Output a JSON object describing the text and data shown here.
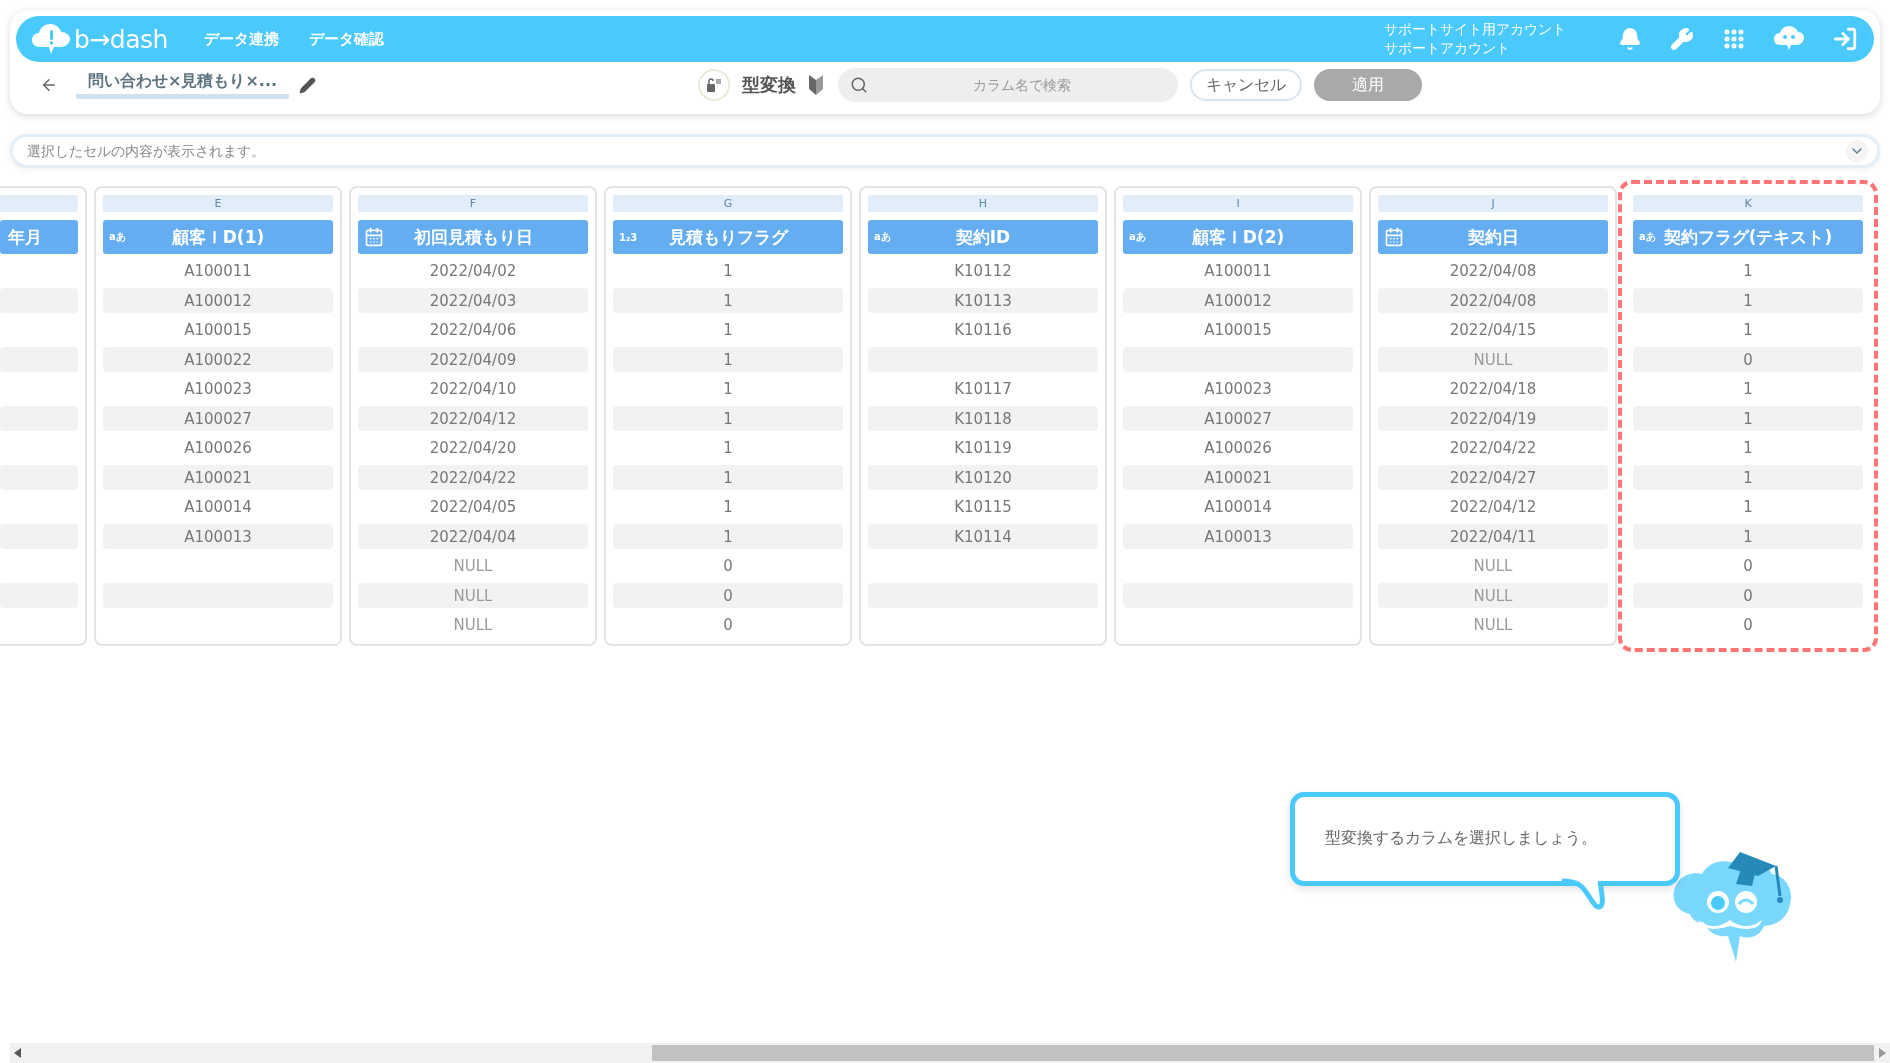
{
  "header": {
    "logo": "b→dash",
    "nav": [
      {
        "label": "データ連携"
      },
      {
        "label": "データ確認"
      }
    ],
    "account": {
      "line1": "サポートサイト用アカウント",
      "line2": "サポートアカウント"
    }
  },
  "toolbar": {
    "title": "問い合わせ×見積もり×...",
    "mode_label": "型変換",
    "search": {
      "placeholder": "カラム名で検索"
    },
    "cancel": {
      "label": "キャンセル",
      "disabled": false
    },
    "apply": {
      "label": "適用",
      "disabled": true
    }
  },
  "cell_bar": {
    "placeholder": "選択したセルの内容が表示されます。"
  },
  "columns": [
    {
      "kind": "partial",
      "title": "年月",
      "highlighted": false,
      "cells": [
        {
          "kind": "empty"
        },
        {
          "kind": "empty"
        },
        {
          "kind": "empty"
        },
        {
          "kind": "empty"
        },
        {
          "kind": "empty"
        },
        {
          "kind": "empty"
        },
        {
          "kind": "empty"
        },
        {
          "kind": "empty"
        },
        {
          "kind": "empty"
        },
        {
          "kind": "empty"
        },
        {
          "kind": "empty"
        },
        {
          "kind": "empty"
        },
        {
          "kind": "empty"
        }
      ]
    },
    {
      "letter": "E",
      "kind": "text",
      "type_label": "aあ",
      "title": "顧客ＩD(1)",
      "highlighted": false,
      "cells": [
        {
          "kind": "value",
          "text": "A100011"
        },
        {
          "kind": "value",
          "text": "A100012"
        },
        {
          "kind": "value",
          "text": "A100015"
        },
        {
          "kind": "value",
          "text": "A100022"
        },
        {
          "kind": "value",
          "text": "A100023"
        },
        {
          "kind": "value",
          "text": "A100027"
        },
        {
          "kind": "value",
          "text": "A100026"
        },
        {
          "kind": "value",
          "text": "A100021"
        },
        {
          "kind": "value",
          "text": "A100014"
        },
        {
          "kind": "value",
          "text": "A100013"
        },
        {
          "kind": "empty"
        },
        {
          "kind": "empty"
        },
        {
          "kind": "empty"
        }
      ]
    },
    {
      "letter": "F",
      "kind": "date",
      "title": "初回見積もり日",
      "highlighted": false,
      "cells": [
        {
          "kind": "value",
          "text": "2022/04/02"
        },
        {
          "kind": "value",
          "text": "2022/04/03"
        },
        {
          "kind": "value",
          "text": "2022/04/06"
        },
        {
          "kind": "value",
          "text": "2022/04/09"
        },
        {
          "kind": "value",
          "text": "2022/04/10"
        },
        {
          "kind": "value",
          "text": "2022/04/12"
        },
        {
          "kind": "value",
          "text": "2022/04/20"
        },
        {
          "kind": "value",
          "text": "2022/04/22"
        },
        {
          "kind": "value",
          "text": "2022/04/05"
        },
        {
          "kind": "value",
          "text": "2022/04/04"
        },
        {
          "kind": "null",
          "text": "NULL"
        },
        {
          "kind": "null",
          "text": "NULL"
        },
        {
          "kind": "null",
          "text": "NULL"
        }
      ]
    },
    {
      "letter": "G",
      "kind": "number",
      "type_label": "1₂3",
      "title": "見積もりフラグ",
      "highlighted": false,
      "cells": [
        {
          "kind": "value",
          "text": "1"
        },
        {
          "kind": "value",
          "text": "1"
        },
        {
          "kind": "value",
          "text": "1"
        },
        {
          "kind": "value",
          "text": "1"
        },
        {
          "kind": "value",
          "text": "1"
        },
        {
          "kind": "value",
          "text": "1"
        },
        {
          "kind": "value",
          "text": "1"
        },
        {
          "kind": "value",
          "text": "1"
        },
        {
          "kind": "value",
          "text": "1"
        },
        {
          "kind": "value",
          "text": "1"
        },
        {
          "kind": "value",
          "text": "0"
        },
        {
          "kind": "value",
          "text": "0"
        },
        {
          "kind": "value",
          "text": "0"
        }
      ]
    },
    {
      "letter": "H",
      "kind": "text",
      "type_label": "aあ",
      "title": "契約ID",
      "highlighted": false,
      "cells": [
        {
          "kind": "value",
          "text": "K10112"
        },
        {
          "kind": "value",
          "text": "K10113"
        },
        {
          "kind": "value",
          "text": "K10116"
        },
        {
          "kind": "empty"
        },
        {
          "kind": "value",
          "text": "K10117"
        },
        {
          "kind": "value",
          "text": "K10118"
        },
        {
          "kind": "value",
          "text": "K10119"
        },
        {
          "kind": "value",
          "text": "K10120"
        },
        {
          "kind": "value",
          "text": "K10115"
        },
        {
          "kind": "value",
          "text": "K10114"
        },
        {
          "kind": "empty"
        },
        {
          "kind": "empty"
        },
        {
          "kind": "empty"
        }
      ]
    },
    {
      "letter": "I",
      "kind": "text",
      "type_label": "aあ",
      "title": "顧客ＩD(2)",
      "highlighted": false,
      "cells": [
        {
          "kind": "value",
          "text": "A100011"
        },
        {
          "kind": "value",
          "text": "A100012"
        },
        {
          "kind": "value",
          "text": "A100015"
        },
        {
          "kind": "empty"
        },
        {
          "kind": "value",
          "text": "A100023"
        },
        {
          "kind": "value",
          "text": "A100027"
        },
        {
          "kind": "value",
          "text": "A100026"
        },
        {
          "kind": "value",
          "text": "A100021"
        },
        {
          "kind": "value",
          "text": "A100014"
        },
        {
          "kind": "value",
          "text": "A100013"
        },
        {
          "kind": "empty"
        },
        {
          "kind": "empty"
        },
        {
          "kind": "empty"
        }
      ]
    },
    {
      "letter": "J",
      "kind": "date",
      "title": "契約日",
      "highlighted": false,
      "cells": [
        {
          "kind": "value",
          "text": "2022/04/08"
        },
        {
          "kind": "value",
          "text": "2022/04/08"
        },
        {
          "kind": "value",
          "text": "2022/04/15"
        },
        {
          "kind": "null",
          "text": "NULL"
        },
        {
          "kind": "value",
          "text": "2022/04/18"
        },
        {
          "kind": "value",
          "text": "2022/04/19"
        },
        {
          "kind": "value",
          "text": "2022/04/22"
        },
        {
          "kind": "value",
          "text": "2022/04/27"
        },
        {
          "kind": "value",
          "text": "2022/04/12"
        },
        {
          "kind": "value",
          "text": "2022/04/11"
        },
        {
          "kind": "null",
          "text": "NULL"
        },
        {
          "kind": "null",
          "text": "NULL"
        },
        {
          "kind": "null",
          "text": "NULL"
        }
      ]
    },
    {
      "letter": "K",
      "kind": "text",
      "type_label": "aあ",
      "title": "契約フラグ(テキスト)",
      "highlighted": true,
      "cells": [
        {
          "kind": "value",
          "text": "1"
        },
        {
          "kind": "value",
          "text": "1"
        },
        {
          "kind": "value",
          "text": "1"
        },
        {
          "kind": "value",
          "text": "0"
        },
        {
          "kind": "value",
          "text": "1"
        },
        {
          "kind": "value",
          "text": "1"
        },
        {
          "kind": "value",
          "text": "1"
        },
        {
          "kind": "value",
          "text": "1"
        },
        {
          "kind": "value",
          "text": "1"
        },
        {
          "kind": "value",
          "text": "1"
        },
        {
          "kind": "value",
          "text": "0"
        },
        {
          "kind": "value",
          "text": "0"
        },
        {
          "kind": "value",
          "text": "0"
        }
      ]
    }
  ],
  "tooltip": {
    "text": "型変換するカラムを選択しましょう。"
  }
}
